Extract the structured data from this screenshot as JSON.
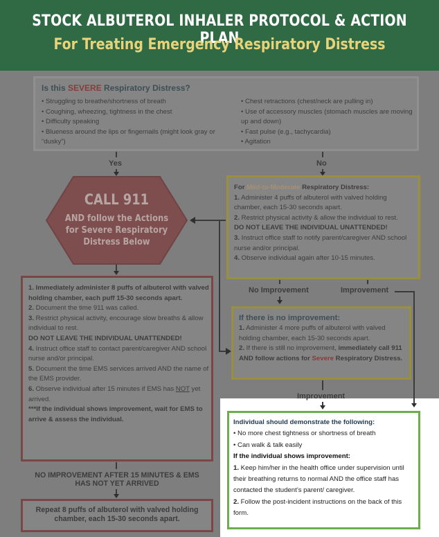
{
  "header": {
    "title": "STOCK ALBUTEROL INHALER PROTOCOL & ACTION PLAN",
    "subtitle": "For Treating Emergency Respiratory Distress"
  },
  "severe": {
    "question_prefix": "Is this ",
    "question_highlight": "SEVERE",
    "question_suffix": " Respiratory Distress?",
    "left_items": [
      "• Struggling to breathe/shortness of breath",
      "• Coughing, wheezing, tightness in the chest",
      "• Difficulty speaking",
      "• Blueness around the lips or fingernails (might look gray or “dusky”)"
    ],
    "right_items": [
      "• Chest retractions (chest/neck are pulling in)",
      "• Use of accessory muscles (stomach muscles are moving up and down)",
      "• Fast pulse (e.g., tachycardia)",
      "• Agitation"
    ],
    "yes_label": "Yes",
    "no_label": "No"
  },
  "call911": {
    "title": "CALL 911",
    "line1": "AND follow the Actions",
    "line2": "for Severe Respiratory",
    "line3": "Distress Below"
  },
  "mild": {
    "heading_prefix": "For ",
    "heading_highlight": "Mild-to-Moderate",
    "heading_suffix": " Respiratory Distress:",
    "step1_num": "1.",
    "step1": " Administer 4 puffs of albuterol with valved holding chamber, each 15-30 seconds apart.",
    "step2_num": "2.",
    "step2": " Restrict physical activity & allow the individual to rest.",
    "warning": "DO NOT LEAVE THE INDIVIDUAL UNATTENDED!",
    "step3_num": "3.",
    "step3": " Instruct office staff to notify parent/caregiver AND school nurse and/or principal.",
    "step4_num": "4.",
    "step4": " Observe individual again after 10-15 minutes.",
    "no_improvement_label": "No Improvement",
    "improvement_label": "Improvement"
  },
  "severe_actions": {
    "step1": "1. Immediately administer 8 puffs of albuterol with valved holding chamber, each puff 15-30 seconds apart.",
    "step2_num": "2.",
    "step2": " Document the time 911 was called.",
    "step3_num": "3.",
    "step3": " Restrict physical activity, encourage slow breaths & allow individual to rest.",
    "warning": "DO NOT LEAVE THE INDIVIDUAL UNATTENDED!",
    "step4_num": "4.",
    "step4": " Instruct office staff to contact parent/caregiver AND school nurse and/or principal.",
    "step5_num": "5.",
    "step5": " Document the time EMS services arrived AND the name of the EMS provider.",
    "step6_num": "6.",
    "step6_prefix": " Observe individual after 15 minutes if EMS has ",
    "step6_not": "NOT",
    "step6_suffix": " yet arrived.",
    "note": "***If the individual shows improvement, wait for EMS to arrive & assess the individual."
  },
  "no_improvement_box": {
    "heading": "If there is no improvement:",
    "step1_num": "1.",
    "step1": " Administer 4 more puffs of albuterol with valved holding chamber, each 15-30 seconds apart.",
    "step2_num": "2.",
    "step2_prefix": " If there is still no improvement, ",
    "step2_bold1": "immediately call 911",
    "step2_bold2": " AND follow actions for ",
    "step2_red": "Severe",
    "step2_bold3": " Respiratory Distress.",
    "improvement_label": "Improvement"
  },
  "improvement_box": {
    "heading": "Individual should demonstrate the following:",
    "item1": "• No more chest tightness or shortness of breath",
    "item2": "• Can walk & talk easily",
    "heading2": "If the individual shows improvement:",
    "step1_num": "1.",
    "step1": " Keep him/her in the health office under supervision until their breathing returns to normal AND the office staff has contacted the student’s parent/ caregiver.",
    "step2_num": "2.",
    "step2": " Follow the post-incident instructions on the back of this form."
  },
  "no_improvement_15": {
    "line1": "NO IMPROVEMENT AFTER 15 MINUTES & EMS",
    "line2": "HAS NOT YET ARRIVED"
  },
  "repeat_box": {
    "line1": "Repeat 8 puffs of albuterol with valved holding",
    "line2": "chamber, each 15-30 seconds apart."
  }
}
